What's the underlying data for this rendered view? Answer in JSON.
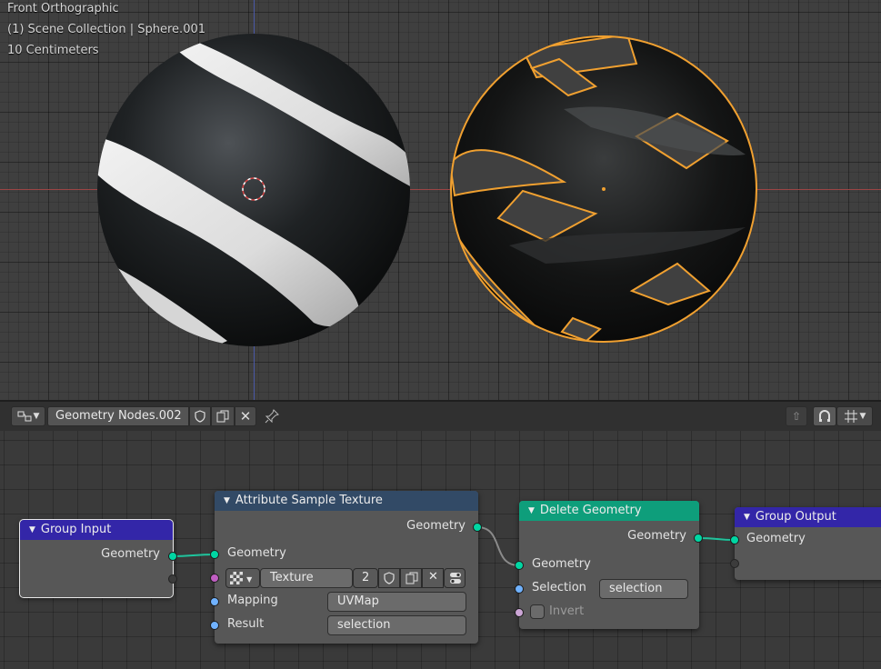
{
  "viewport": {
    "view_name": "Front Orthographic",
    "collection_info": "(1) Scene Collection | Sphere.001",
    "grid_scale": "10 Centimeters"
  },
  "node_editor": {
    "tree_name": "Geometry Nodes.002"
  },
  "nodes": {
    "group_input": {
      "title": "Group Input",
      "header_color": "#3326a8",
      "outputs": [
        "Geometry"
      ]
    },
    "attribute_sample_texture": {
      "title": "Attribute Sample Texture",
      "header_color": "#324a66",
      "output": "Geometry",
      "input_geometry": "Geometry",
      "texture_name": "Texture",
      "texture_users": "2",
      "mapping_label": "Mapping",
      "mapping_value": "UVMap",
      "result_label": "Result",
      "result_value": "selection"
    },
    "delete_geometry": {
      "title": "Delete Geometry",
      "header_color": "#0e9e7b",
      "output": "Geometry",
      "input_geometry": "Geometry",
      "selection_label": "Selection",
      "selection_value": "selection",
      "invert_label": "Invert"
    },
    "group_output": {
      "title": "Group Output",
      "header_color": "#3326a8",
      "input_geometry": "Geometry"
    }
  },
  "colors": {
    "selection_outline": "#f0a030",
    "x_axis": "#9b4444",
    "z_axis": "#4a59a8",
    "geometry_socket": "#00d6a3"
  },
  "icons": {
    "editor_type": "node-editor-icon",
    "fake_user": "shield-icon",
    "duplicate": "duplicate-icon",
    "unlink": "close-icon",
    "pin": "pin-icon",
    "snap": "snap-icon",
    "overlay": "overlay-icon"
  }
}
